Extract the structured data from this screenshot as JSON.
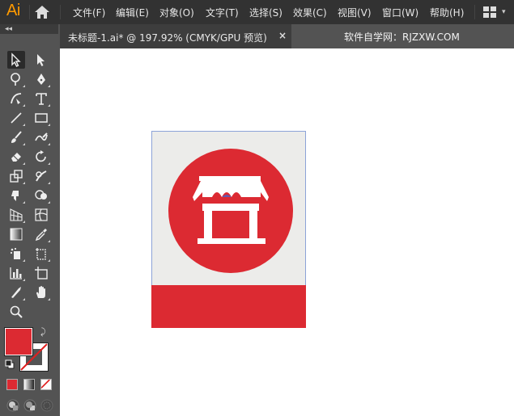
{
  "app": {
    "logo": "Ai"
  },
  "menu": [
    {
      "label": "文件(F)"
    },
    {
      "label": "编辑(E)"
    },
    {
      "label": "对象(O)"
    },
    {
      "label": "文字(T)"
    },
    {
      "label": "选择(S)"
    },
    {
      "label": "效果(C)"
    },
    {
      "label": "视图(V)"
    },
    {
      "label": "窗口(W)"
    },
    {
      "label": "帮助(H)"
    }
  ],
  "tabbar": {
    "collapse": "◂◂",
    "document_title": "未标题-1.ai* @ 197.92% (CMYK/GPU 预览)",
    "close": "×",
    "watermark": "软件自学网：RJZXW.COM"
  },
  "colors": {
    "fill": "#dc2a32",
    "stroke": "#ffffff",
    "accent": "#ff9a00",
    "artboard_bg": "#ececea"
  },
  "toolbar": {
    "tools": [
      "selection-tool",
      "direct-selection-tool",
      "magic-wand-tool",
      "pen-tool",
      "curvature-tool",
      "type-tool",
      "line-tool",
      "rectangle-tool",
      "paintbrush-tool",
      "shaper-tool",
      "eraser-tool",
      "rotate-tool",
      "scale-tool",
      "warp-tool",
      "free-transform-tool",
      "shape-builder-tool",
      "perspective-grid-tool",
      "mesh-tool",
      "gradient-tool",
      "eyedropper-tool",
      "symbol-sprayer-tool",
      "artboard-tool-alt",
      "column-graph-tool",
      "artboard-tool",
      "slice-tool",
      "hand-tool",
      "zoom-tool"
    ]
  }
}
